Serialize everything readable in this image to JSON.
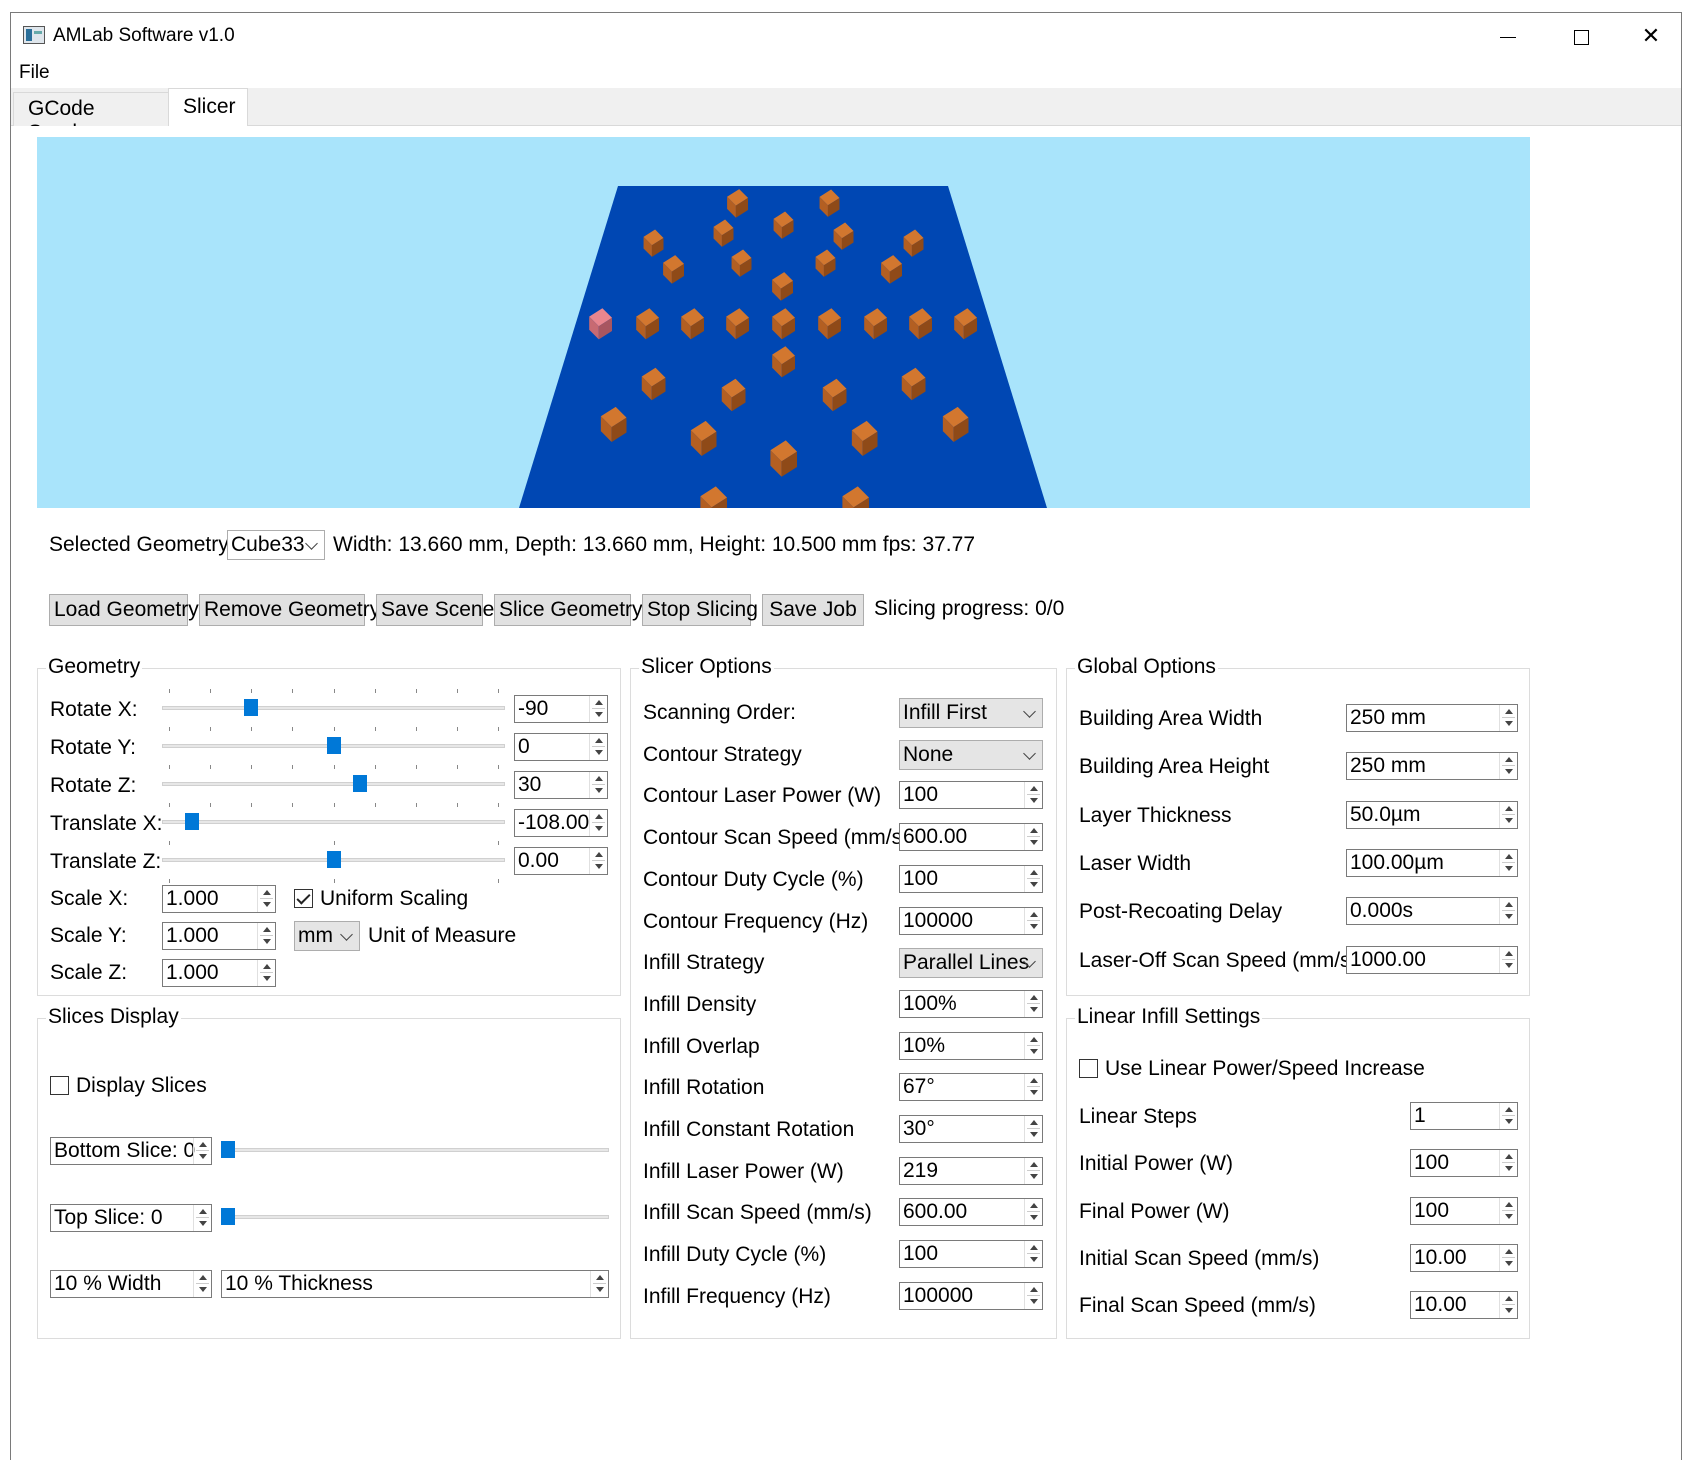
{
  "window": {
    "title": "AMLab Software v1.0"
  },
  "menu": {
    "file": "File"
  },
  "tabs": [
    {
      "label": "GCode Sender"
    },
    {
      "label": "Slicer"
    }
  ],
  "selection": {
    "label": "Selected Geometry:",
    "value": "Cube33",
    "dimensions": "Width: 13.660 mm, Depth: 13.660 mm, Height: 10.500 mm",
    "fps": "fps: 37.77"
  },
  "toolbar": {
    "load": "Load Geometry",
    "remove": "Remove Geometry",
    "save_scene": "Save Scene",
    "slice": "Slice Geometry",
    "stop": "Stop Slicing",
    "save_job": "Save Job",
    "progress": "Slicing progress: 0/0"
  },
  "geometry": {
    "title": "Geometry",
    "rotate_x": {
      "label": "Rotate X:",
      "value": "-90",
      "level": 0.25
    },
    "rotate_y": {
      "label": "Rotate Y:",
      "value": "0",
      "level": 0.5
    },
    "rotate_z": {
      "label": "Rotate Z:",
      "value": "30",
      "level": 0.58
    },
    "translate_x": {
      "label": "Translate X:",
      "value": "-108.00",
      "level": 0.07
    },
    "translate_z": {
      "label": "Translate Z:",
      "value": "0.00",
      "level": 0.5
    },
    "scale_x": {
      "label": "Scale X:",
      "value": "1.000"
    },
    "scale_y": {
      "label": "Scale Y:",
      "value": "1.000"
    },
    "scale_z": {
      "label": "Scale Z:",
      "value": "1.000"
    },
    "uniform_scaling": "Uniform Scaling",
    "unit_value": "mm",
    "unit_label": "Unit of Measure"
  },
  "slices": {
    "title": "Slices Display",
    "display": "Display Slices",
    "bottom": "Bottom Slice: 0",
    "top": "Top Slice: 0",
    "width": "10 % Width",
    "thickness": "10 % Thickness"
  },
  "slicer": {
    "title": "Slicer Options",
    "rows": [
      {
        "label": "Scanning Order:",
        "value": "Infill First",
        "kind": "combo"
      },
      {
        "label": "Contour Strategy",
        "value": "None",
        "kind": "combo"
      },
      {
        "label": "Contour Laser Power (W)",
        "value": "100",
        "kind": "spin"
      },
      {
        "label": "Contour Scan Speed (mm/s)",
        "value": "600.00",
        "kind": "spin"
      },
      {
        "label": "Contour Duty Cycle (%)",
        "value": "100",
        "kind": "spin"
      },
      {
        "label": "Contour Frequency (Hz)",
        "value": "100000",
        "kind": "spin"
      },
      {
        "label": "Infill Strategy",
        "value": "Parallel Lines",
        "kind": "combo"
      },
      {
        "label": "Infill Density",
        "value": "100%",
        "kind": "spin"
      },
      {
        "label": "Infill Overlap",
        "value": "10%",
        "kind": "spin"
      },
      {
        "label": "Infill Rotation",
        "value": "67°",
        "kind": "spin"
      },
      {
        "label": "Infill Constant Rotation",
        "value": "30°",
        "kind": "spin"
      },
      {
        "label": "Infill Laser Power (W)",
        "value": "219",
        "kind": "spin"
      },
      {
        "label": "Infill Scan Speed (mm/s)",
        "value": "600.00",
        "kind": "spin"
      },
      {
        "label": "Infill Duty Cycle (%)",
        "value": "100",
        "kind": "spin"
      },
      {
        "label": "Infill Frequency (Hz)",
        "value": "100000",
        "kind": "spin"
      }
    ]
  },
  "global": {
    "title": "Global Options",
    "rows": [
      {
        "label": "Building Area Width",
        "value": "250 mm"
      },
      {
        "label": "Building Area Height",
        "value": "250 mm"
      },
      {
        "label": "Layer Thickness",
        "value": "50.0µm"
      },
      {
        "label": "Laser Width",
        "value": "100.00µm"
      },
      {
        "label": "Post-Recoating Delay",
        "value": "0.000s"
      },
      {
        "label": "Laser-Off Scan Speed (mm/s)",
        "value": "1000.00"
      }
    ]
  },
  "linear": {
    "title": "Linear Infill Settings",
    "use": "Use Linear Power/Speed Increase",
    "rows": [
      {
        "label": "Linear Steps",
        "value": "1"
      },
      {
        "label": "Initial Power (W)",
        "value": "100"
      },
      {
        "label": "Final Power (W)",
        "value": "100"
      },
      {
        "label": "Initial Scan Speed (mm/s)",
        "value": "10.00"
      },
      {
        "label": "Final Scan Speed (mm/s)",
        "value": "10.00"
      }
    ]
  },
  "colors": {
    "sky": "#a9e4fb",
    "plate": "#0047b3",
    "cube": "#d2772f",
    "cube_selected": "#e9868e",
    "accent": "#0078d7"
  }
}
